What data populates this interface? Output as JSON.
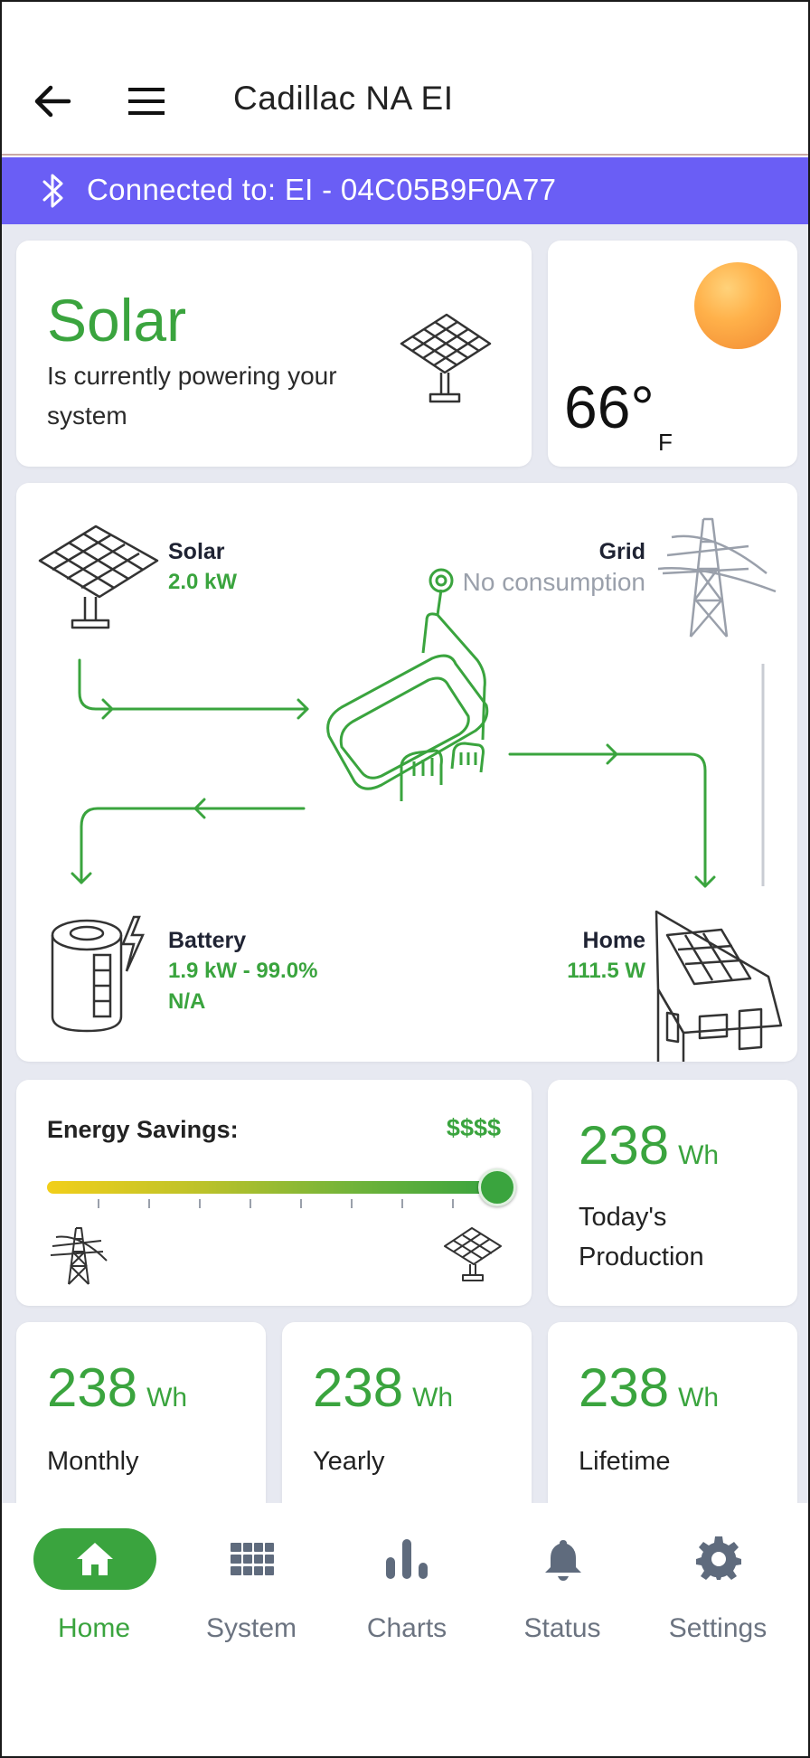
{
  "header": {
    "title": "Cadillac NA EI"
  },
  "connection": {
    "text": "Connected to: EI - 04C05B9F0A77"
  },
  "source_card": {
    "source": "Solar",
    "description": "Is currently powering your system"
  },
  "weather": {
    "temperature": "66°",
    "unit": "F"
  },
  "flow": {
    "solar": {
      "label": "Solar",
      "value": "2.0 kW"
    },
    "grid": {
      "label": "Grid",
      "value": "No consumption"
    },
    "battery": {
      "label": "Battery",
      "value": "1.9 kW - 99.0%",
      "status": "N/A"
    },
    "home": {
      "label": "Home",
      "value": "111.5 W"
    }
  },
  "savings": {
    "title": "Energy Savings:",
    "rating": "$$$$",
    "level_fraction": 1.0
  },
  "metrics": {
    "today": {
      "value": "238",
      "unit": "Wh",
      "label": "Today's Production"
    },
    "monthly": {
      "value": "238",
      "unit": "Wh",
      "label": "Monthly"
    },
    "yearly": {
      "value": "238",
      "unit": "Wh",
      "label": "Yearly"
    },
    "lifetime": {
      "value": "238",
      "unit": "Wh",
      "label": "Lifetime"
    }
  },
  "nav": {
    "items": [
      {
        "label": "Home",
        "icon": "home-icon",
        "active": true
      },
      {
        "label": "System",
        "icon": "grid-icon",
        "active": false
      },
      {
        "label": "Charts",
        "icon": "bar-chart-icon",
        "active": false
      },
      {
        "label": "Status",
        "icon": "bell-icon",
        "active": false
      },
      {
        "label": "Settings",
        "icon": "gear-icon",
        "active": false
      }
    ]
  },
  "colors": {
    "accent_green": "#3aa43e",
    "bluetooth_bar": "#6a5ef5",
    "background": "#e7e9f1"
  }
}
